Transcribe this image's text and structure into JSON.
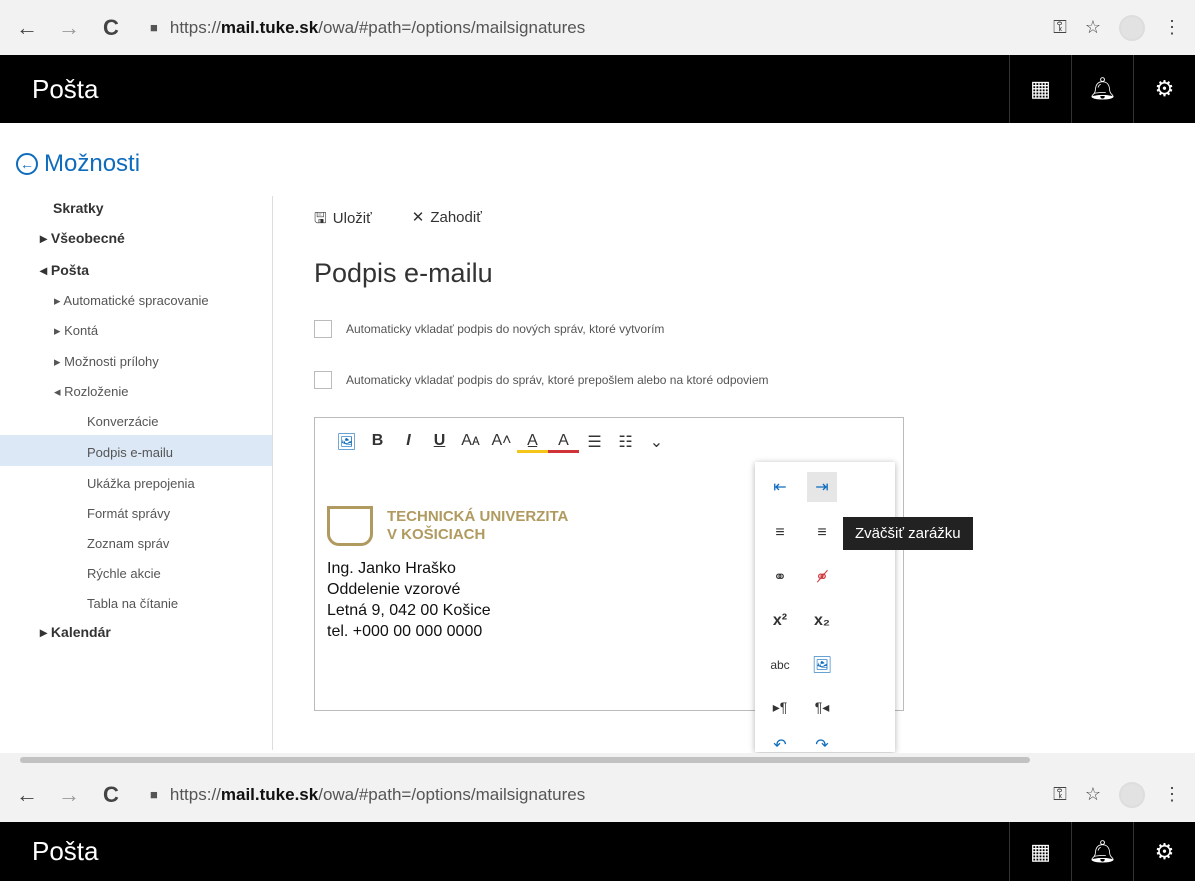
{
  "browser": {
    "back": "←",
    "forward": "→",
    "reload": "C",
    "url_scheme": "https://",
    "url_host": "mail.tuke.sk",
    "url_path": "/owa/#path=/options/mailsignatures",
    "key_icon": "⚿",
    "star_icon": "☆",
    "menu_icon": "⋮"
  },
  "topbar": {
    "title": "Pošta"
  },
  "back_link": "Možnosti",
  "nav": [
    {
      "label": "Skratky"
    },
    {
      "label": "▸ Všeobecné"
    },
    {
      "label": "◂ Pošta"
    },
    {
      "label": "▸ Automatické spracovanie"
    },
    {
      "label": "▸ Kontá"
    },
    {
      "label": "▸ Možnosti prílohy"
    },
    {
      "label": "◂ Rozloženie"
    },
    {
      "label": "Konverzácie"
    },
    {
      "label": "Podpis e-mailu"
    },
    {
      "label": "Ukážka prepojenia"
    },
    {
      "label": "Formát správy"
    },
    {
      "label": "Zoznam správ"
    },
    {
      "label": "Rýchle akcie"
    },
    {
      "label": "Tabla na čítanie"
    },
    {
      "label": "▸ Kalendár"
    }
  ],
  "actions": {
    "save": "Uložiť",
    "discard": "Zahodiť"
  },
  "heading": "Podpis e-mailu",
  "options": {
    "new_messages": "Automaticky vkladať podpis do nových správ, ktoré vytvorím",
    "reply_forward": "Automaticky vkladať podpis do správ, ktoré prepošlem alebo na ktoré odpoviem"
  },
  "editor_tools": [
    "🖼",
    "B",
    "I",
    "U",
    "Aᴀ",
    "A˄",
    "A̲",
    "A",
    "☰",
    "☷",
    "⌄"
  ],
  "signature": {
    "logo_line1": "TECHNICKÁ UNIVERZITA",
    "logo_line2": "V KOŠICIACH",
    "name": "Ing. Janko Hraško",
    "dept": "Oddelenie vzorové",
    "address": "Letná 9, 042 00 Košice",
    "phone": "tel. +000 00 000 0000"
  },
  "popup_tools": [
    "⇤",
    "⇥",
    "≡",
    "≡",
    "⚭",
    "⚭̸",
    "x²",
    "x₂",
    "abc",
    "🖼",
    "▸¶",
    "¶◂",
    "↶",
    "↷"
  ],
  "tooltip": "Zväčšiť zarážku"
}
